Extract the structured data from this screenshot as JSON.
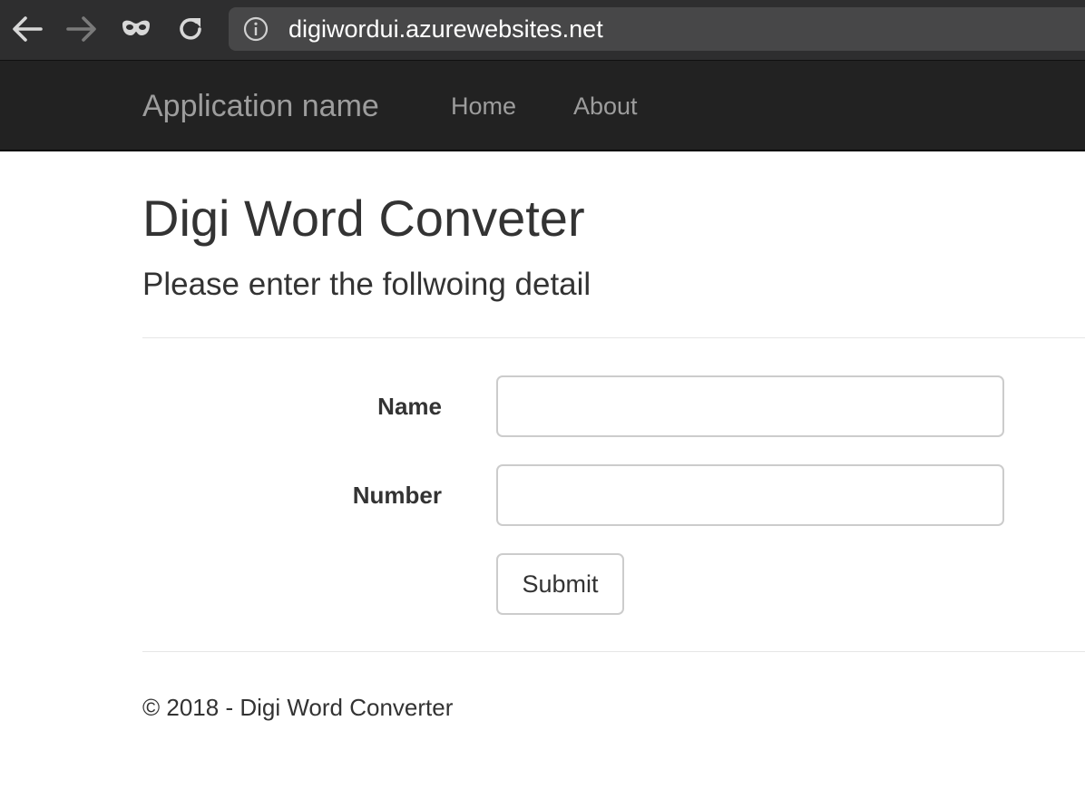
{
  "browser": {
    "url": "digiwordui.azurewebsites.net",
    "icons": {
      "back": "arrow-left-icon",
      "forward": "arrow-right-icon",
      "incognito": "incognito-mask-icon",
      "reload": "reload-icon",
      "info": "info-circle-icon"
    },
    "colors": {
      "chrome_bg": "#2e2e2f",
      "address_bg": "#474748"
    }
  },
  "navbar": {
    "brand": "Application name",
    "links": [
      {
        "label": "Home"
      },
      {
        "label": "About"
      }
    ],
    "colors": {
      "bg": "#222222",
      "link": "#9d9d9d"
    }
  },
  "main": {
    "title": "Digi Word Conveter",
    "subtitle": "Please enter the follwoing detail",
    "form": {
      "fields": [
        {
          "label": "Name",
          "value": "",
          "placeholder": ""
        },
        {
          "label": "Number",
          "value": "",
          "placeholder": ""
        }
      ],
      "submit_label": "Submit"
    }
  },
  "footer": {
    "text": "© 2018 - Digi Word Converter"
  }
}
